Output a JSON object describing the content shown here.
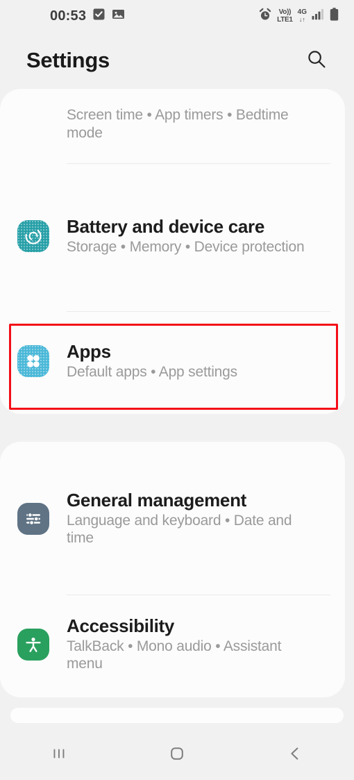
{
  "status_bar": {
    "time": "00:53",
    "left_icons": [
      "tasks-checkbox-icon",
      "gallery-image-icon"
    ],
    "right_icons": [
      "alarm-icon",
      "volte-icon",
      "network-4g-icon",
      "signal-bars-icon",
      "battery-icon"
    ],
    "volte_line1": "Vo))",
    "volte_line2": "LTE1",
    "network_line1": "4G",
    "network_line2": "↓↑"
  },
  "app_bar": {
    "title": "Settings",
    "search_icon": "search-icon"
  },
  "cards": [
    {
      "name": "settings-card-primary",
      "rows": [
        {
          "name": "digital-wellbeing",
          "title": "",
          "subtitle": "Screen time • App timers • Bedtime mode",
          "icon": "digital-wellbeing-icon",
          "icon_color": "#4d9ba0",
          "clipped_top": true
        },
        {
          "name": "battery-and-device-care",
          "title": "Battery and device care",
          "subtitle": "Storage • Memory • Device protection",
          "icon": "device-care-icon",
          "icon_color": "#28a0a8"
        },
        {
          "name": "apps",
          "title": "Apps",
          "subtitle": "Default apps • App settings",
          "icon": "apps-grid-icon",
          "icon_color": "#4bb8d8",
          "highlighted": true
        }
      ]
    },
    {
      "name": "settings-card-secondary",
      "rows": [
        {
          "name": "general-management",
          "title": "General management",
          "subtitle": "Language and keyboard • Date and time",
          "icon": "sliders-icon",
          "icon_color": "#5f7384"
        },
        {
          "name": "accessibility",
          "title": "Accessibility",
          "subtitle": "TalkBack • Mono audio • Assistant menu",
          "icon": "accessibility-person-icon",
          "icon_color": "#29a05e"
        }
      ]
    }
  ],
  "highlight": {
    "name": "apps-row-highlight",
    "color": "#f40e18"
  },
  "nav_bar": {
    "recents_icon": "recents-icon",
    "home_icon": "home-icon",
    "back_icon": "back-icon"
  },
  "colors": {
    "background": "#f1f1f1",
    "card": "#fcfcfc",
    "title_text": "#1c1c1c",
    "subtitle_text": "#9a9a9a",
    "divider": "#eaeaea"
  }
}
